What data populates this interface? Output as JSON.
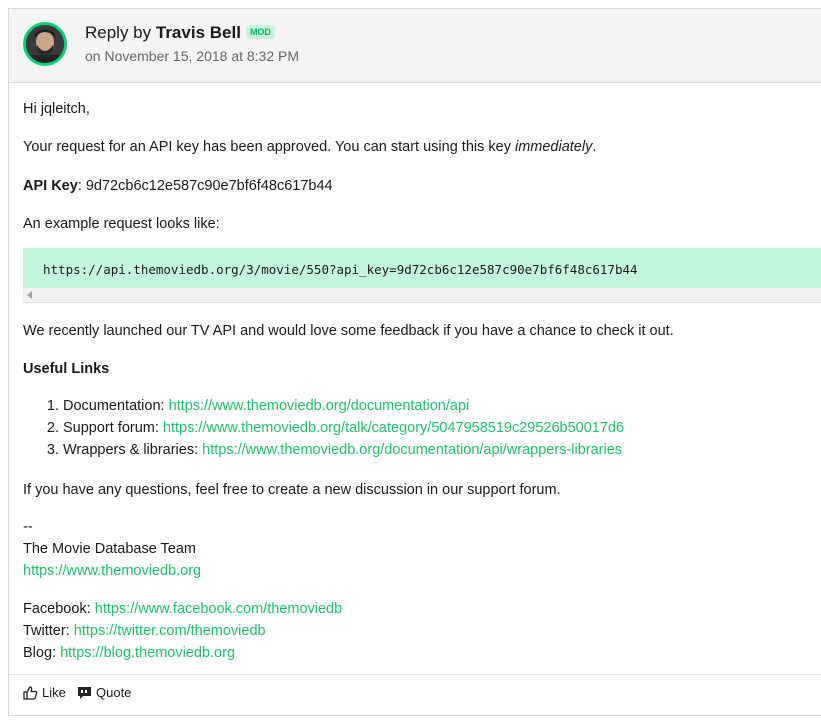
{
  "header": {
    "reply_prefix": "Reply by",
    "author": "Travis Bell",
    "badge": "MOD",
    "date": "on November 15, 2018 at 8:32 PM"
  },
  "post": {
    "greeting": "Hi jqleitch,",
    "approval_text": "Your request for an API key has been approved. You can start using this key ",
    "approval_emphasis": "immediately",
    "approval_end": ".",
    "api_key_label": "API Key",
    "api_key_value": ": 9d72cb6c12e587c90e7bf6f48c617b44",
    "example_intro": "An example request looks like:",
    "example_code": "https://api.themoviedb.org/3/movie/550?api_key=9d72cb6c12e587c90e7bf6f48c617b44",
    "tv_api_text": "We recently launched our TV API and would love some feedback if you have a chance to check it out.",
    "useful_links_heading": "Useful Links",
    "links": [
      {
        "label": "Documentation: ",
        "url": "https://www.themoviedb.org/documentation/api"
      },
      {
        "label": "Support forum: ",
        "url": "https://www.themoviedb.org/talk/category/5047958519c29526b50017d6"
      },
      {
        "label": "Wrappers & libraries: ",
        "url": "https://www.themoviedb.org/documentation/api/wrappers-libraries"
      }
    ],
    "questions_text": "If you have any questions, feel free to create a new discussion in our support forum.",
    "sig_dash": "--",
    "sig_team": "The Movie Database Team",
    "sig_url": "https://www.themoviedb.org",
    "social": [
      {
        "label": "Facebook: ",
        "url": "https://www.facebook.com/themoviedb"
      },
      {
        "label": "Twitter: ",
        "url": "https://twitter.com/themoviedb"
      },
      {
        "label": "Blog: ",
        "url": "https://blog.themoviedb.org"
      }
    ]
  },
  "footer": {
    "like_label": "Like",
    "quote_label": "Quote"
  },
  "colors": {
    "accent": "#01d277",
    "link": "#21c16b",
    "code_bg": "#c3f6dc"
  }
}
